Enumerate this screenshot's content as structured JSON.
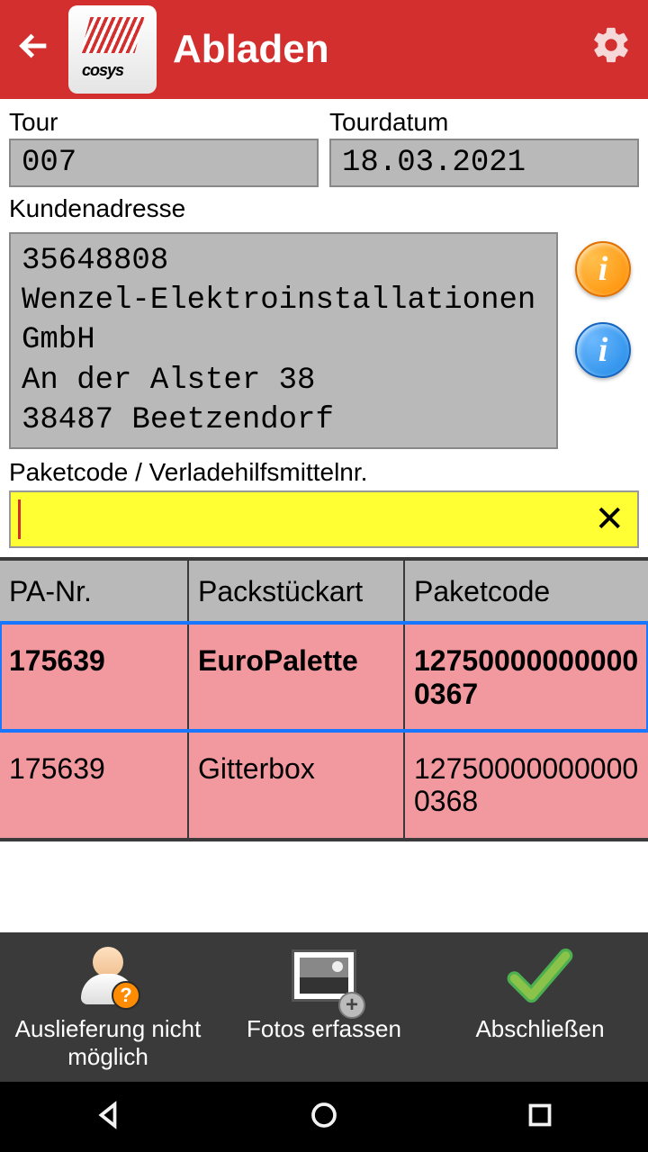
{
  "header": {
    "title": "Abladen"
  },
  "fields": {
    "tour_label": "Tour",
    "tour_value": "007",
    "date_label": "Tourdatum",
    "date_value": "18.03.2021",
    "address_label": "Kundenadresse",
    "address_value": "35648808\nWenzel-Elektroinstallationen GmbH\nAn der Alster 38\n38487 Beetzendorf",
    "scan_label": "Paketcode / Verladehilfsmittelnr."
  },
  "table": {
    "headers": {
      "c1": "PA-Nr.",
      "c2": "Packstückart",
      "c3": "Paketcode"
    },
    "rows": [
      {
        "c1": "175639",
        "c2": "EuroPalette",
        "c3": "127500000000000367",
        "selected": true
      },
      {
        "c1": "175639",
        "c2": "Gitterbox",
        "c3": "127500000000000368",
        "selected": false
      }
    ]
  },
  "actions": {
    "not_possible": "Auslieferung nicht möglich",
    "photos": "Fotos erfassen",
    "finish": "Abschließen"
  }
}
